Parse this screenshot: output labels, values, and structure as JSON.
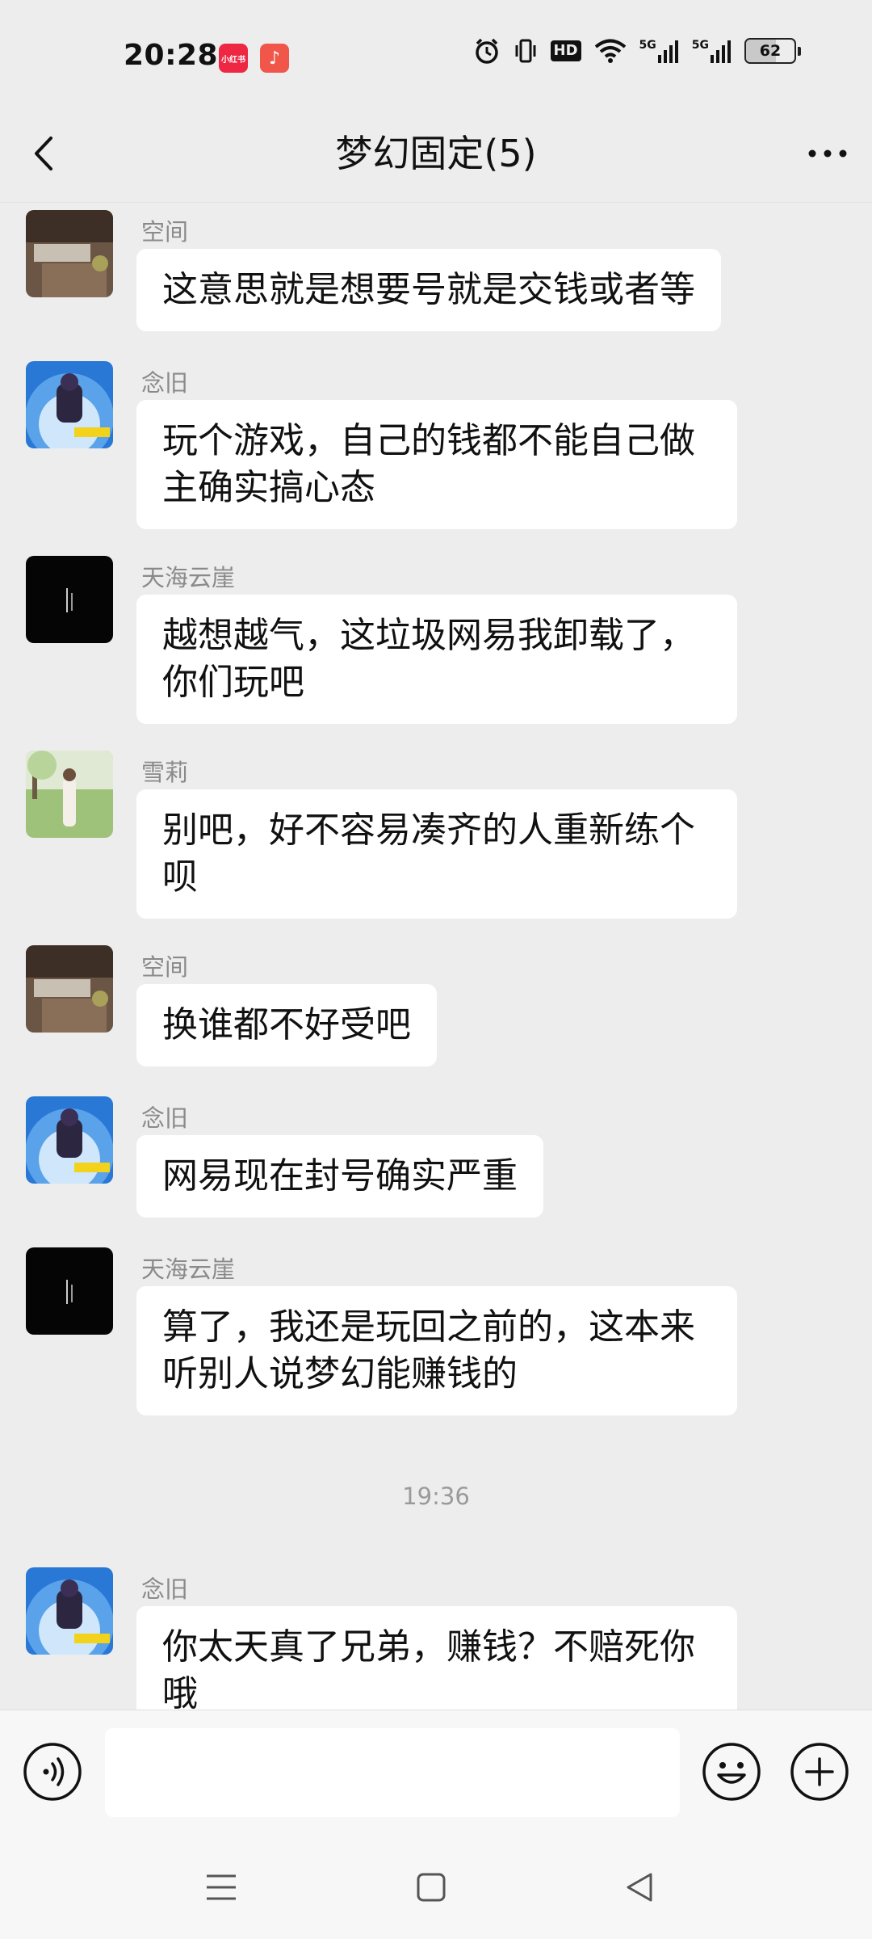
{
  "status_bar": {
    "time": "20:28",
    "app_icon_1": "小红书",
    "app_icon_2": "music-note-icon",
    "hd_label": "HD",
    "net1_label": "5G",
    "net2_label": "5G",
    "battery_percent": "62",
    "battery_level": 0.62
  },
  "header": {
    "title": "梦幻固定(5)"
  },
  "messages": [
    {
      "sender": "空间",
      "text": "这意思就是想要号就是交钱或者等"
    },
    {
      "sender": "念旧",
      "text": "玩个游戏，自己的钱都不能自己做主确实搞心态"
    },
    {
      "sender": "天海云崖",
      "text": "越想越气，这垃圾网易我卸载了，你们玩吧"
    },
    {
      "sender": "雪莉",
      "text": "别吧，好不容易凑齐的人重新练个呗"
    },
    {
      "sender": "空间",
      "text": "换谁都不好受吧"
    },
    {
      "sender": "念旧",
      "text": "网易现在封号确实严重"
    },
    {
      "sender": "天海云崖",
      "text": "算了，我还是玩回之前的，这本来听别人说梦幻能赚钱的"
    },
    {
      "sender": "念旧",
      "text": "你太天真了兄弟，赚钱？不赔死你哦"
    }
  ],
  "timestamp": "19:36",
  "input": {
    "value": "",
    "placeholder": ""
  },
  "colors": {
    "background": "#ededed",
    "bubble": "#ffffff",
    "sender_name": "#8a8a8a"
  }
}
